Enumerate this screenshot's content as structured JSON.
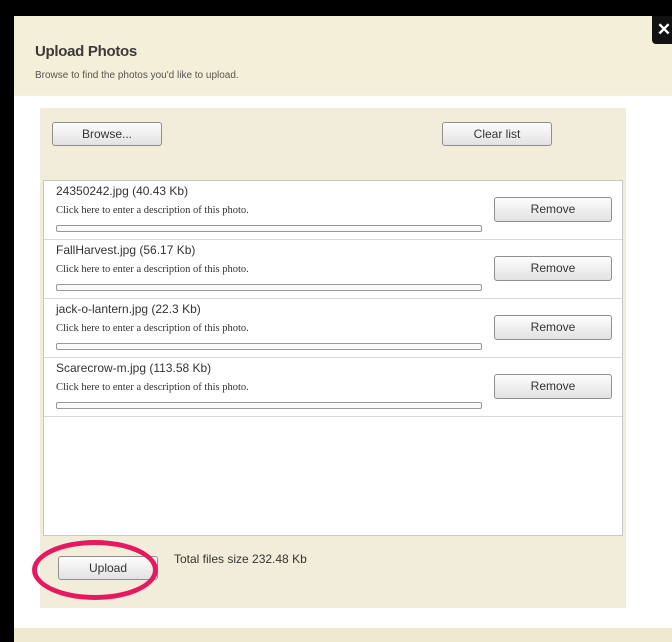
{
  "dialog": {
    "title": "Upload Photos",
    "subtitle": "Browse to find the photos you'd like to upload.",
    "close_symbol": "✕"
  },
  "toolbar": {
    "browse_label": "Browse...",
    "clear_label": "Clear list"
  },
  "files": [
    {
      "name": "24350242.jpg (40.43 Kb)",
      "description": "Click here to enter a description of this photo.",
      "remove_label": "Remove"
    },
    {
      "name": "FallHarvest.jpg (56.17 Kb)",
      "description": "Click here to enter a description of this photo.",
      "remove_label": "Remove"
    },
    {
      "name": "jack-o-lantern.jpg (22.3 Kb)",
      "description": "Click here to enter a description of this photo.",
      "remove_label": "Remove"
    },
    {
      "name": "Scarecrow-m.jpg (113.58 Kb)",
      "description": "Click here to enter a description of this photo.",
      "remove_label": "Remove"
    }
  ],
  "footer": {
    "upload_label": "Upload",
    "total_size": "Total files size 232.48 Kb"
  },
  "colors": {
    "highlight_ring": "#e5195f",
    "dialog_bg": "#f5f1dc",
    "frame": "#000000"
  }
}
